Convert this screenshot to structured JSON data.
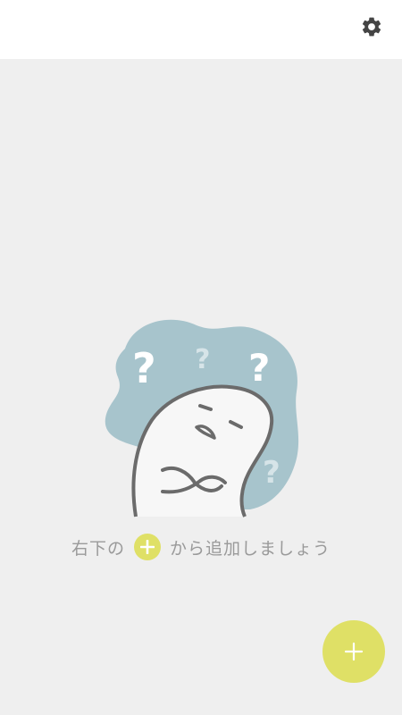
{
  "header": {
    "settings_icon": "gear-icon"
  },
  "empty_state": {
    "illustration_icon": "confused-ghost-illustration",
    "hint_prefix": "右下の",
    "hint_suffix": "から追加しましょう",
    "hint_icon": "plus-icon"
  },
  "fab": {
    "icon": "plus-icon"
  },
  "colors": {
    "background": "#efefef",
    "header": "#ffffff",
    "accent": "#dfe066",
    "blob": "#a7c4cc",
    "text": "#9a9a9a"
  }
}
